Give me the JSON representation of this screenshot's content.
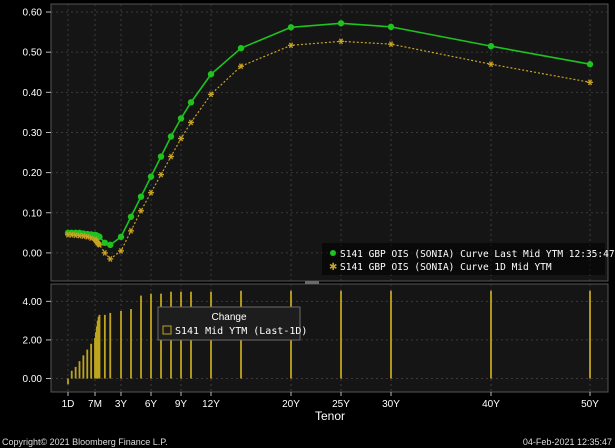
{
  "chart_data": [
    {
      "type": "line",
      "xlabel": "Tenor",
      "x_tick_labels": [
        "1D",
        "7M",
        "3Y",
        "6Y",
        "9Y",
        "12Y",
        "20Y",
        "25Y",
        "30Y",
        "40Y",
        "50Y"
      ],
      "x_tick_years": [
        0.003,
        0.583,
        3,
        6,
        9,
        12,
        20,
        25,
        30,
        40,
        50
      ],
      "ylim": [
        -0.07,
        0.62
      ],
      "y_ticks": [
        0.0,
        0.1,
        0.2,
        0.3,
        0.4,
        0.5,
        0.6
      ],
      "y_tick_labels": [
        "0.00",
        "0.10",
        "0.20",
        "0.30",
        "0.40",
        "0.50",
        "0.60"
      ],
      "grid": true,
      "legend_position": "bottom-right",
      "series": [
        {
          "name": "S141 GBP OIS (SONIA) Curve Last Mid YTM 12:35:47",
          "color": "#1ec31e",
          "marker": "circle",
          "points": [
            [
              0.003,
              0.05
            ],
            [
              0.083,
              0.05
            ],
            [
              0.167,
              0.05
            ],
            [
              0.25,
              0.05
            ],
            [
              0.333,
              0.048
            ],
            [
              0.417,
              0.047
            ],
            [
              0.5,
              0.046
            ],
            [
              0.583,
              0.045
            ],
            [
              0.667,
              0.044
            ],
            [
              0.75,
              0.043
            ],
            [
              0.833,
              0.042
            ],
            [
              0.917,
              0.041
            ],
            [
              1,
              0.04
            ],
            [
              1.5,
              0.025
            ],
            [
              2,
              0.02
            ],
            [
              3,
              0.04
            ],
            [
              4,
              0.09
            ],
            [
              5,
              0.14
            ],
            [
              6,
              0.19
            ],
            [
              7,
              0.24
            ],
            [
              8,
              0.29
            ],
            [
              9,
              0.335
            ],
            [
              10,
              0.375
            ],
            [
              12,
              0.445
            ],
            [
              15,
              0.51
            ],
            [
              20,
              0.562
            ],
            [
              25,
              0.572
            ],
            [
              30,
              0.563
            ],
            [
              40,
              0.515
            ],
            [
              50,
              0.47
            ]
          ]
        },
        {
          "name": "S141 GBP OIS (SONIA) Curve 1D Mid YTM",
          "color": "#c8a326",
          "marker": "star",
          "points": [
            [
              0.003,
              0.045
            ],
            [
              0.083,
              0.045
            ],
            [
              0.167,
              0.044
            ],
            [
              0.25,
              0.043
            ],
            [
              0.333,
              0.042
            ],
            [
              0.417,
              0.04
            ],
            [
              0.5,
              0.037
            ],
            [
              0.583,
              0.034
            ],
            [
              0.667,
              0.031
            ],
            [
              0.75,
              0.028
            ],
            [
              0.833,
              0.025
            ],
            [
              0.917,
              0.022
            ],
            [
              1,
              0.02
            ],
            [
              1.5,
              0.0
            ],
            [
              2,
              -0.015
            ],
            [
              3,
              0.005
            ],
            [
              4,
              0.055
            ],
            [
              5,
              0.105
            ],
            [
              6,
              0.15
            ],
            [
              7,
              0.195
            ],
            [
              8,
              0.24
            ],
            [
              9,
              0.285
            ],
            [
              10,
              0.325
            ],
            [
              12,
              0.395
            ],
            [
              15,
              0.465
            ],
            [
              20,
              0.517
            ],
            [
              25,
              0.527
            ],
            [
              30,
              0.52
            ],
            [
              40,
              0.47
            ],
            [
              50,
              0.425
            ]
          ]
        }
      ]
    },
    {
      "type": "bar",
      "title": "Change",
      "xlabel": "Tenor",
      "ylim": [
        -0.7,
        4.9
      ],
      "y_ticks": [
        0.0,
        2.0,
        4.0
      ],
      "y_tick_labels": [
        "0.00",
        "2.00",
        "4.00"
      ],
      "grid": true,
      "legend_position": "top-center",
      "series": [
        {
          "name": "S141 Mid YTM (Last-1D)",
          "color": "#bfa51e",
          "points": [
            [
              0.003,
              -0.3
            ],
            [
              0.083,
              0.4
            ],
            [
              0.167,
              0.6
            ],
            [
              0.25,
              0.9
            ],
            [
              0.333,
              1.2
            ],
            [
              0.417,
              1.5
            ],
            [
              0.5,
              1.8
            ],
            [
              0.583,
              2.1
            ],
            [
              0.667,
              2.4
            ],
            [
              0.75,
              2.7
            ],
            [
              0.833,
              3.0
            ],
            [
              0.917,
              3.2
            ],
            [
              1,
              3.3
            ],
            [
              1.5,
              3.3
            ],
            [
              2,
              3.4
            ],
            [
              3,
              3.5
            ],
            [
              4,
              3.6
            ],
            [
              5,
              4.3
            ],
            [
              6,
              4.4
            ],
            [
              7,
              4.4
            ],
            [
              8,
              4.5
            ],
            [
              9,
              4.5
            ],
            [
              10,
              4.5
            ],
            [
              12,
              4.5
            ],
            [
              15,
              4.55
            ],
            [
              20,
              4.55
            ],
            [
              25,
              4.55
            ],
            [
              30,
              4.55
            ],
            [
              40,
              4.55
            ],
            [
              50,
              4.55
            ]
          ]
        }
      ]
    }
  ],
  "footer": {
    "copyright": "Copyright© 2021 Bloomberg Finance L.P.",
    "timestamp": "04-Feb-2021 12:35:47"
  }
}
